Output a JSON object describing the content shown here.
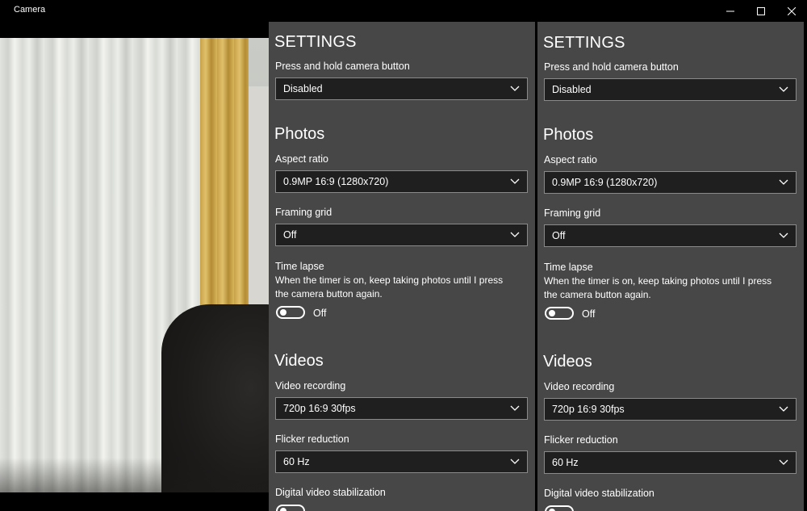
{
  "window": {
    "title": "Camera"
  },
  "settings": {
    "title": "SETTINGS",
    "press_hold": {
      "label": "Press and hold camera button",
      "value": "Disabled"
    },
    "photos": {
      "heading": "Photos",
      "aspect_ratio": {
        "label": "Aspect ratio",
        "value": "0.9MP 16:9 (1280x720)"
      },
      "framing_grid": {
        "label": "Framing grid",
        "value": "Off"
      },
      "time_lapse": {
        "label": "Time lapse",
        "description": "When the timer is on, keep taking photos until I press the camera button again.",
        "state": "Off"
      }
    },
    "videos": {
      "heading": "Videos",
      "video_recording": {
        "label": "Video recording",
        "value": "720p 16:9 30fps"
      },
      "flicker_reduction": {
        "label": "Flicker reduction",
        "value": "60 Hz"
      },
      "stabilization": {
        "label": "Digital video stabilization"
      }
    }
  },
  "colors": {
    "panel_bg": "#474747",
    "dropdown_bg": "#1f1f1f",
    "titlebar_bg": "#000000"
  }
}
